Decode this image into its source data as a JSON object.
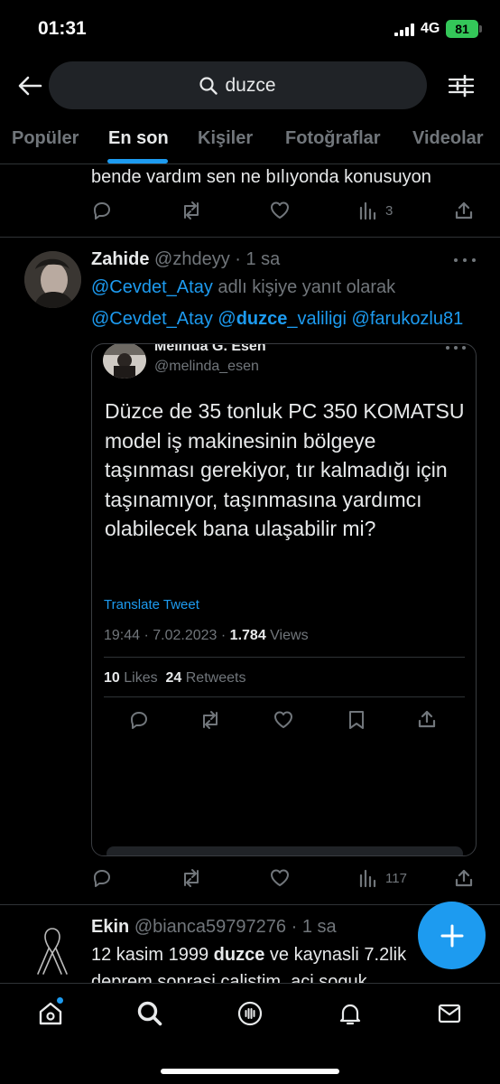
{
  "status_bar": {
    "time": "01:31",
    "network": "4G",
    "battery": "81"
  },
  "search": {
    "query": "duzce",
    "icons": [
      "back-arrow-icon",
      "search-icon",
      "filter-sliders-icon"
    ]
  },
  "tabs": [
    {
      "label": "Popüler",
      "active": false
    },
    {
      "label": "En son",
      "active": true
    },
    {
      "label": "Kişiler",
      "active": false
    },
    {
      "label": "Fotoğraflar",
      "active": false
    },
    {
      "label": "Videolar",
      "active": false
    }
  ],
  "tweet1": {
    "text": "bende vardım sen ne bılıyonda konusuyon",
    "views": "3"
  },
  "tweet2": {
    "name": "Zahide",
    "handle": "@zhdeyy",
    "time": "· 1 sa",
    "reply_to_user": "@Cevdet_Atay",
    "reply_suffix": "adlı kişiye yanıt olarak",
    "mention1": "@Cevdet_Atay",
    "mention2_prefix": "@",
    "mention2_bold": "duzce",
    "mention2_suffix": "_valiligi",
    "mention3": "@farukozlu81",
    "views": "117",
    "quoted": {
      "name": "Melinda G. Esen",
      "handle": "@melinda_esen",
      "body": "Düzce de 35 tonluk PC 350 KOMATSU model iş makinesinin bölgeye taşınması gerekiyor, tır kalmadığı için taşınamıyor, taşınmasına yardımcı olabilecek bana ulaşabilir mi?",
      "translate": "Translate Tweet",
      "datetime": "19:44 · 7.02.2023 ·",
      "view_count": "1.784",
      "views_label": "Views",
      "likes_count": "10",
      "likes_label": "Likes",
      "retweets_count": "24",
      "retweets_label": "Retweets"
    }
  },
  "tweet3": {
    "name": "Ekin",
    "handle": "@bianca59797276",
    "time": "· 1 sa",
    "line1_prefix": "12 kasim 1999",
    "line1_bold": "duzce",
    "line1_suffix": "ve kaynasli  7.2lik",
    "line2": "deprem sonrasi calistim, aci soguk"
  },
  "colors": {
    "background": "#000000",
    "accent": "#1d9bf0",
    "text": "#e7e9ea",
    "muted": "#71767b",
    "battery": "#34c759"
  }
}
